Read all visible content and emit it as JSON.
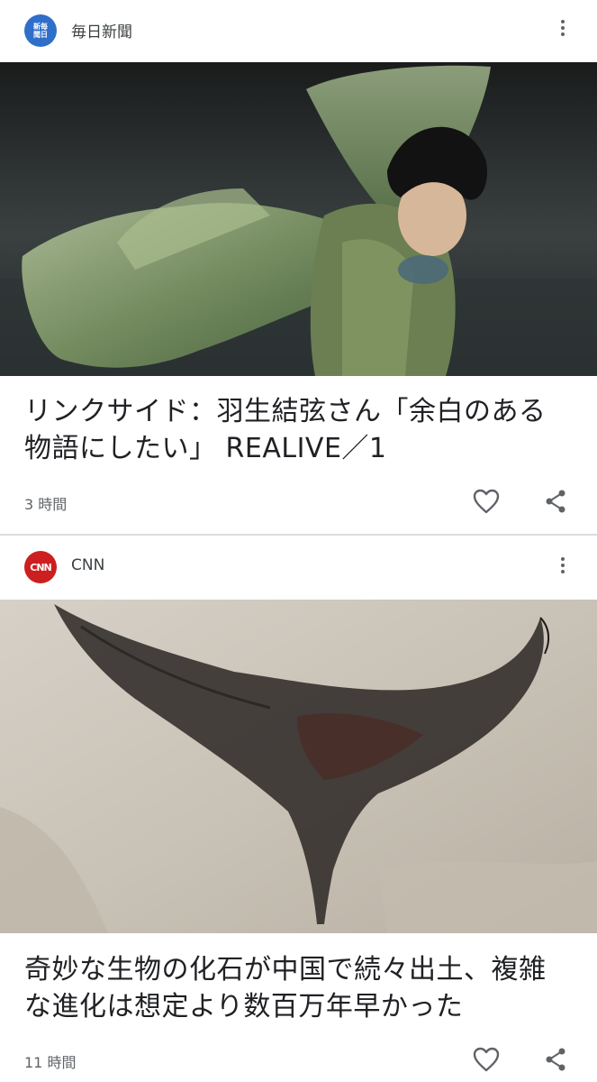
{
  "articles": [
    {
      "source": {
        "name": "毎日新聞",
        "logo_text": "新毎聞日",
        "logo_color": "#2f6fc9"
      },
      "headline": "リンクサイド：羽生結弦さん「余白のある物語にしたい」 REALIVE／1",
      "time": "3 時間",
      "image_subject": "figure skater in flowing green costume"
    },
    {
      "source": {
        "name": "CNN",
        "logo_text": "CNN",
        "logo_color": "#cc1f1f"
      },
      "headline": "奇妙な生物の化石が中国で続々出土、複雑な進化は想定より数百万年早かった",
      "time": "11 時間",
      "image_subject": "dark fossil imprint on pale stone"
    }
  ],
  "icons": {
    "more": "more-vert-icon",
    "like": "heart-outline-icon",
    "share": "share-icon"
  }
}
